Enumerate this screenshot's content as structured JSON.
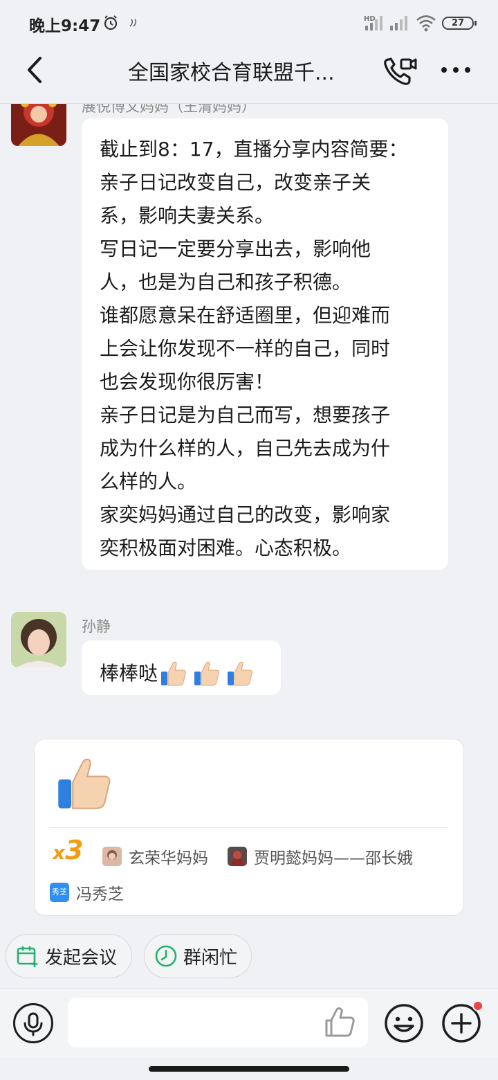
{
  "status_bar": {
    "time": "晚上9:47",
    "hd_label": "HD",
    "battery": "27"
  },
  "header": {
    "title": "全国家校合育联盟千...",
    "icons": {
      "back": "chevron-left-icon",
      "call": "phone-video-icon",
      "more": "more-dots-icon"
    }
  },
  "messages": [
    {
      "sender": "展悦博文妈妈（王清妈妈）",
      "lines": [
        "截止到8：17，直播分享内容简要：",
        "亲子日记改变自己，改变亲子关",
        "系，影响夫妻关系。",
        "写日记一定要分享出去，影响他",
        "人，也是为自己和孩子积德。",
        "谁都愿意呆在舒适圈里，但迎难而",
        "上会让你发现不一样的自己，同时",
        "也会发现你很厉害！",
        "亲子日记是为自己而写，想要孩子",
        "成为什么样的人，自己先去成为什",
        "么样的人。",
        "家奕妈妈通过自己的改变，影响家",
        "奕积极面对困难。心态积极。"
      ]
    },
    {
      "sender": "孙静",
      "text": "棒棒哒"
    }
  ],
  "reaction_card": {
    "emoji": "thumbs-up-icon",
    "count_prefix": "x",
    "count": "3",
    "reactors": [
      {
        "name": "玄荣华妈妈"
      },
      {
        "name": "贾明懿妈妈——邵长娥"
      },
      {
        "name": "冯秀芝",
        "badge": "秀芝"
      }
    ]
  },
  "actions": [
    {
      "label": "发起会议",
      "icon": "calendar-add-icon"
    },
    {
      "label": "群闲忙",
      "icon": "clock-icon"
    }
  ],
  "input_bar": {
    "placeholder": "",
    "icons": [
      "microphone-icon",
      "thumbs-up-icon",
      "emoji-icon",
      "plus-icon"
    ]
  },
  "colors": {
    "background": "#f0f1f4",
    "bubble": "#ffffff",
    "reaction_count": "#f39c12",
    "badge_blue": "#2f8ef4",
    "chip_icon_green": "#23b26d",
    "notification_dot": "#f04444"
  }
}
